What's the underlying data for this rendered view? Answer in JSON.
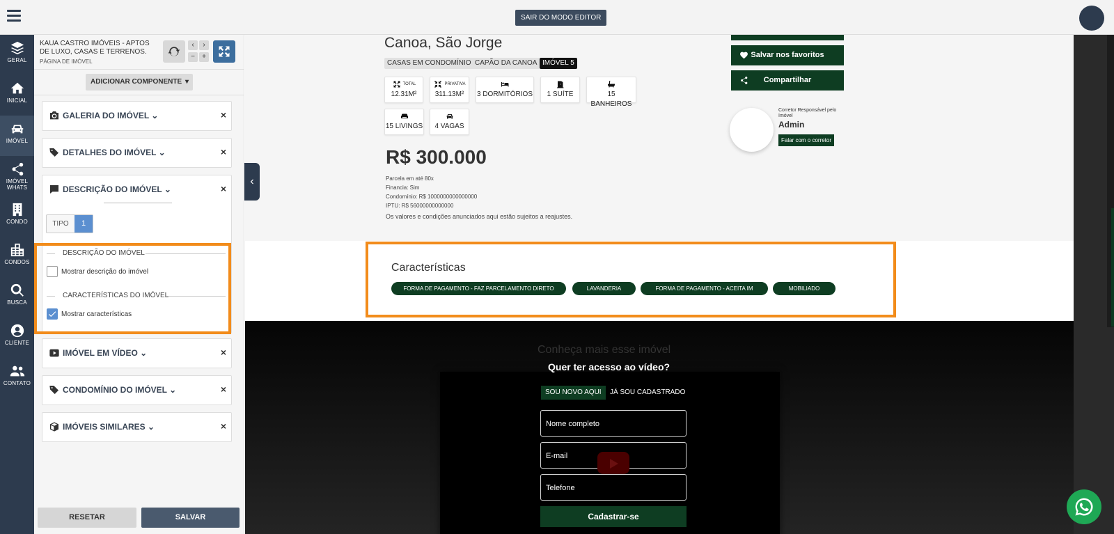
{
  "topbar": {
    "exit_editor": "SAIR DO MODO EDITOR"
  },
  "rail": {
    "items": [
      {
        "icon": "layers-icon",
        "label": "GERAL"
      },
      {
        "icon": "home-icon",
        "label": "INICIAL"
      },
      {
        "icon": "car-icon",
        "label": "IMÓVEL"
      },
      {
        "icon": "share-icon",
        "label": "IMÓVEL",
        "label2": "WHATS"
      },
      {
        "icon": "building-icon",
        "label": "CONDO"
      },
      {
        "icon": "city-icon",
        "label": "CONDOS"
      },
      {
        "icon": "search-icon",
        "label": "BUSCA"
      },
      {
        "icon": "user-icon",
        "label": "CLIENTE"
      },
      {
        "icon": "users-icon",
        "label": "CONTATO"
      }
    ]
  },
  "panel": {
    "site_title": "KAUA CASTRO IMÓVEIS - APTOS DE LUXO, CASAS E TERRENOS.",
    "site_sub": "PÁGINA DE IMÓVEL",
    "add_component": "ADICIONAR COMPONENTE",
    "components": {
      "gallery": "GALERIA DO IMÓVEL",
      "details": "DETALHES DO IMÓVEL",
      "description": "DESCRIÇÃO DO IMÓVEL",
      "video": "IMÓVEL EM VÍDEO",
      "condo": "CONDOMÍNIO DO IMÓVEL",
      "similar": "IMÓVEIS SIMILARES"
    },
    "close_glyph": "×",
    "tipo_label": "TIPO",
    "tipo_value": "1",
    "desc_legend": "DESCRIÇÃO DO IMÓVEL",
    "desc_checkbox": "Mostrar descrição do imóvel",
    "feat_legend": "CARACTERÍSTICAS DO IMÓVEL",
    "feat_checkbox": "Mostrar características",
    "reset": "RESETAR",
    "save": "SALVAR"
  },
  "property": {
    "title": "Canoa, São Jorge",
    "tags": [
      "CASAS EM CONDOMÍNIO",
      "CAPÃO DA CANOA",
      "IMÓVEL 5"
    ],
    "specs": {
      "total_label": "TOTAL",
      "total": "12.31M²",
      "priv_label": "PRIVATIVA",
      "priv": "311.13M²",
      "rooms": "3 DORMITÓRIOS",
      "suite": "1 SUÍTE",
      "baths": "15 BANHEIROS",
      "livings": "15 LIVINGS",
      "parking": "4 VAGAS"
    },
    "price": "R$ 300.000",
    "fine": {
      "installments": "Parcela em até 80x",
      "financing": "Financia: Sim",
      "condo": "Condomínio: R$ 1000000000000000",
      "iptu": "IPTU: R$ 56000000000000",
      "note": "Os valores e condições anunciados aqui estão sujeitos a reajustes."
    },
    "favorite": "Salvar nos favoritos",
    "share": "Compartilhar",
    "agent_caption": "Corretor Responsável pelo Imóvel",
    "agent_name": "Admin",
    "agent_button": "Falar com o corretor"
  },
  "features": {
    "title": "Características",
    "pills": [
      "FORMA DE PAGAMENTO - FAZ PARCELAMENTO DIRETO",
      "LAVANDERIA",
      "FORMA DE PAGAMENTO - ACEITA IM",
      "MOBILIADO"
    ]
  },
  "video_section": {
    "heading": "Conheça mais esse imóvel",
    "modal_title": "Quer ter acesso ao vídeo?",
    "tab_new": "SOU NOVO AQUI",
    "tab_registered": "JÁ SOU CADASTRADO",
    "name_field": "Nome completo",
    "email_field": "E-mail",
    "phone_field": "Telefone",
    "register": "Cadastrar-se"
  },
  "colors": {
    "rail": "#2d3b4e",
    "brand_green": "#0e3d22",
    "highlight": "#f28c1b",
    "accent_blue": "#5b8fd0",
    "whatsapp": "#1fa855"
  }
}
